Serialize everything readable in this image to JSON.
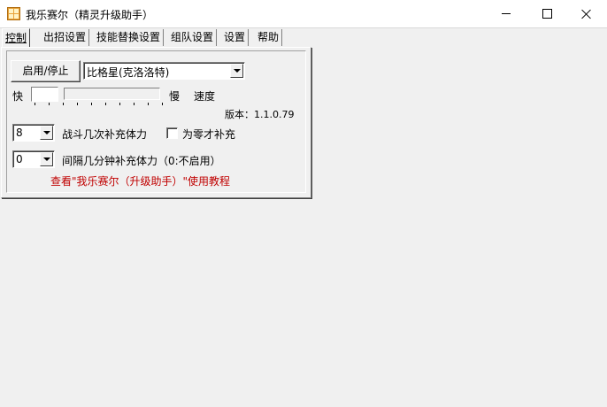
{
  "window": {
    "title": "我乐赛尔（精灵升级助手）"
  },
  "tabs": [
    {
      "label": "控制",
      "active": true
    },
    {
      "label": "出招设置",
      "active": false
    },
    {
      "label": "技能替换设置",
      "active": false
    },
    {
      "label": "组队设置",
      "active": false
    },
    {
      "label": "设置",
      "active": false
    },
    {
      "label": "帮助",
      "active": false
    }
  ],
  "control": {
    "start_stop_label": "启用/停止",
    "pet_select_value": "比格星(克洛洛特)",
    "speed_fast_label": "快",
    "speed_slow_label": "慢",
    "speed_label": "速度",
    "version_text": "版本：1.1.0.79",
    "battles_combo_value": "8",
    "battles_label": "战斗几次补充体力",
    "zero_only_checked": false,
    "zero_only_label": "为零才补充",
    "interval_combo_value": "0",
    "interval_label": "间隔几分钟补充体力（0:不启用）",
    "tutorial_link": "查看\"我乐赛尔（升级助手）\"使用教程"
  },
  "colors": {
    "link": "#c00000",
    "background": "#f0f0f0"
  }
}
